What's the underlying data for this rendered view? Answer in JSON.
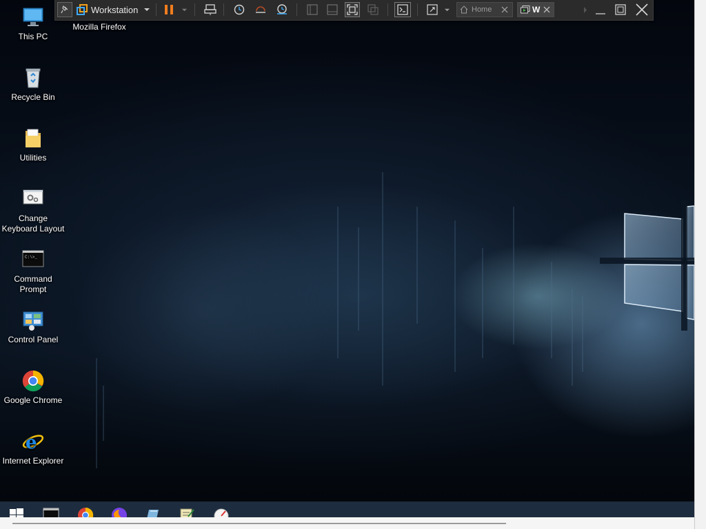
{
  "desktop": {
    "icons": [
      {
        "label": "This PC",
        "icon": "this-pc-icon"
      },
      {
        "label": "Mozilla Firefox",
        "icon": "firefox-icon"
      },
      {
        "label": "Recycle Bin",
        "icon": "recycle-bin-icon"
      },
      {
        "label": "Utilities",
        "icon": "folder-icon"
      },
      {
        "label": "Change Keyboard Layout",
        "icon": "keyboard-layout-icon"
      },
      {
        "label": "Command Prompt",
        "icon": "command-prompt-icon"
      },
      {
        "label": "Control Panel",
        "icon": "control-panel-icon"
      },
      {
        "label": "Google Chrome",
        "icon": "chrome-icon"
      },
      {
        "label": "Internet Explorer",
        "icon": "internet-explorer-icon"
      }
    ]
  },
  "vmware_toolbar": {
    "menu_label": "Workstation",
    "tabs": [
      {
        "label": "Home",
        "icon": "home-icon",
        "active": false
      },
      {
        "label": "W",
        "icon": "vm-icon",
        "active": true
      }
    ],
    "colors": {
      "pause": "#f07d1e",
      "background": "#2b2b2b",
      "accent": "#3fa9f5"
    }
  },
  "taskbar": {
    "items": [
      "start-icon",
      "command-prompt-icon",
      "chrome-icon",
      "firefox-icon",
      "notepad-icon",
      "paint-icon",
      "gauge-icon"
    ],
    "color": "#1d2c3e"
  }
}
